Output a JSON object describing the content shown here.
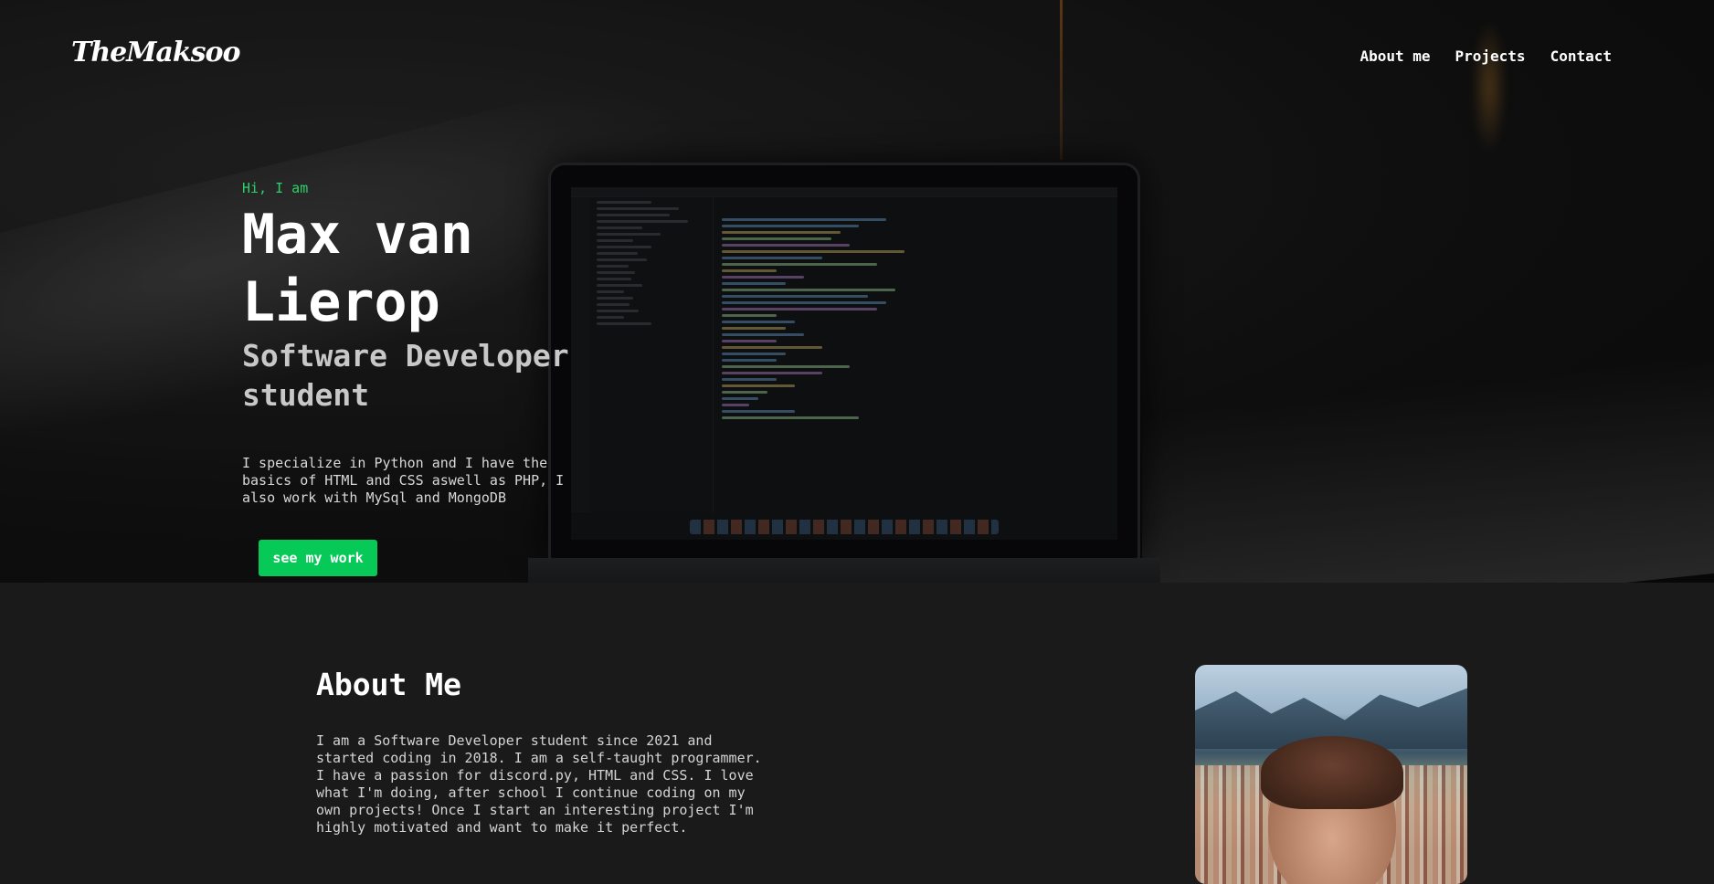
{
  "header": {
    "logo": "TheMaksoo",
    "nav": [
      {
        "label": "About me"
      },
      {
        "label": "Projects"
      },
      {
        "label": "Contact"
      }
    ]
  },
  "hero": {
    "greeting": "Hi, I am",
    "name": "Max van Lierop",
    "role": "Software Developer student",
    "intro": "I specialize in Python and I have the basics of HTML and CSS aswell as PHP, I also work with MySql and MongoDB",
    "cta_label": "see my work"
  },
  "about": {
    "title": "About Me",
    "text": "I am a Software Developer student since 2021 and started coding in 2018. I am a self-taught programmer. I have a passion for discord.py, HTML and CSS. I love what I'm doing, after school I continue coding on my own projects! Once I start an interesting project I'm highly motivated and want to make it perfect."
  },
  "colors": {
    "accent": "#06c958",
    "greeting": "#2ad26a",
    "background": "#1a1a1a"
  }
}
